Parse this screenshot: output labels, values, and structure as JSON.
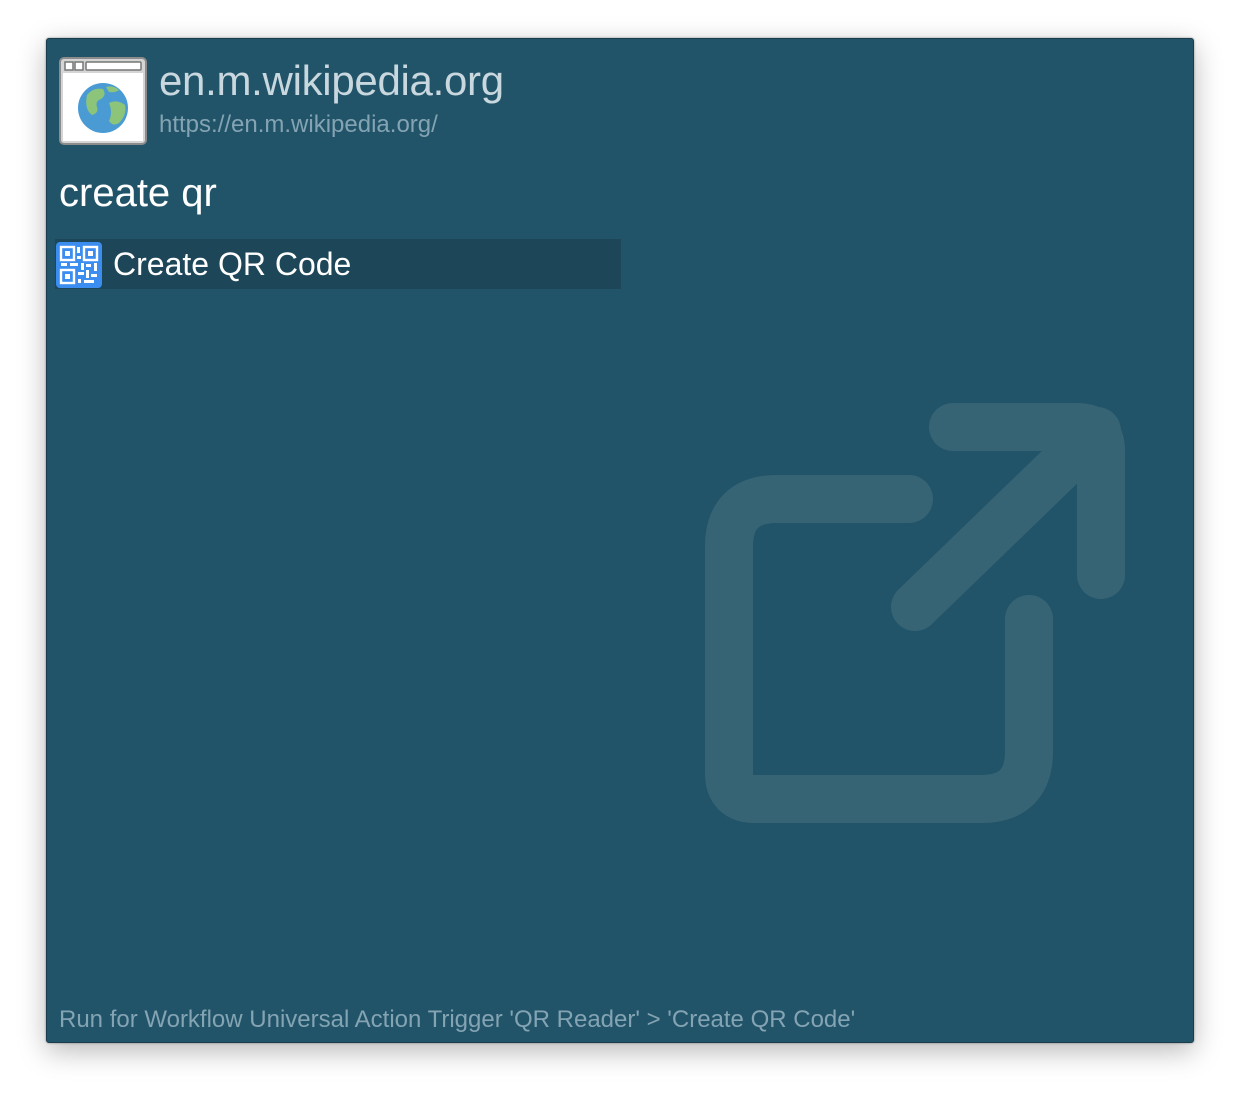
{
  "header": {
    "title": "en.m.wikipedia.org",
    "url": "https://en.m.wikipedia.org/",
    "icon": "browser-globe-icon"
  },
  "search": {
    "query": "create qr"
  },
  "results": [
    {
      "label": "Create QR Code",
      "icon": "qr-code-icon",
      "selected": true
    }
  ],
  "footer": {
    "text": "Run for Workflow Universal Action Trigger 'QR Reader' > 'Create QR Code'"
  },
  "background_icon": "open-external-icon",
  "colors": {
    "window_bg": "#215469",
    "selected_row": "#1d4659",
    "text_primary": "#ffffff",
    "text_secondary": "#84a3b3"
  }
}
